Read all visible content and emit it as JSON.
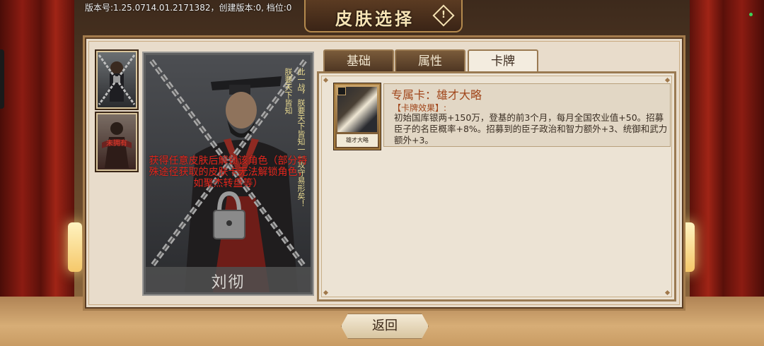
{
  "window": {
    "title": "皮肤选择",
    "version_text": "版本号:1.25.0714.01.2171382，创建版本:0, 档位:0"
  },
  "thumbnails": [
    {
      "label": ""
    },
    {
      "label": "未拥有"
    }
  ],
  "portrait": {
    "name": "刘彻",
    "unlock_message": "获得任意皮肤后解锁该角色（部分特殊途径获取的皮肤卡无法解锁角色，如聚杰转盘等）",
    "quote_col_1": "朕要天下皆知",
    "quote_col_2": "此一战，朕要天下皆知一一攻守易形矣！"
  },
  "tabs": [
    {
      "label": "基础",
      "active": false
    },
    {
      "label": "属性",
      "active": false
    },
    {
      "label": "卡牌",
      "active": true
    }
  ],
  "card": {
    "image_label": "雄才大略",
    "title": "专属卡：雄才大略",
    "effect_label": "【卡牌效果】:",
    "effect_text": "初始国库银两+150万，登基的前3个月，每月全国农业值+50。招募臣子的名臣概率+8%。招募到的臣子政治和智力额外+3、统御和武力额外+3。"
  },
  "footer": {
    "back_label": "返回"
  },
  "colors": {
    "unlock_text": "#e0241b",
    "card_title": "#a0451a",
    "status_dot": "#3cd35a"
  }
}
